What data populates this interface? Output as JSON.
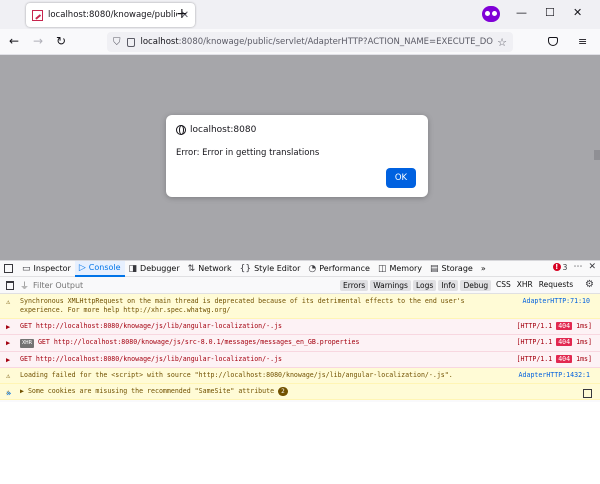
{
  "browser": {
    "tab_title": "localhost:8080/knowage/public",
    "tab_close": "✕",
    "new_tab": "+",
    "window_controls": {
      "minimize": "—",
      "maximize": "☐",
      "close": "✕"
    },
    "nav": {
      "back": "←",
      "forward": "→",
      "reload": "↻",
      "star": "☆",
      "menu": "≡"
    },
    "url_host": "localhost",
    "url_rest": ":8080/knowage/public/servlet/AdapterHTTP?ACTION_NAME=EXECUTE_DOCU"
  },
  "dialog": {
    "origin": "localhost:8080",
    "message": "Error: Error in getting translations",
    "ok_label": "OK"
  },
  "devtools": {
    "tabs": [
      {
        "label": "Inspector",
        "icon": "▭"
      },
      {
        "label": "Console",
        "icon": "▷"
      },
      {
        "label": "Debugger",
        "icon": "◨"
      },
      {
        "label": "Network",
        "icon": "⇅"
      },
      {
        "label": "Style Editor",
        "icon": "{}"
      },
      {
        "label": "Performance",
        "icon": "◔"
      },
      {
        "label": "Memory",
        "icon": "◫"
      },
      {
        "label": "Storage",
        "icon": "▤"
      },
      {
        "label": "»",
        "icon": ""
      }
    ],
    "error_count": "3",
    "filter_placeholder": "Filter Output",
    "filter_buttons": [
      "Errors",
      "Warnings",
      "Logs",
      "Info",
      "Debug"
    ],
    "filter_links": [
      "CSS",
      "XHR",
      "Requests"
    ],
    "messages": [
      {
        "type": "warning",
        "text": "Synchronous XMLHttpRequest on the main thread is deprecated because of its detrimental effects to the end user's experience. For more help http://xhr.spec.whatwg.org/",
        "location": "AdapterHTTP:71:10"
      },
      {
        "type": "error",
        "text": "GET http://localhost:8080/knowage/js/lib/angular-localization/-.js",
        "http": "[HTTP/1.1",
        "code": "404",
        "time": "1ms]"
      },
      {
        "type": "error",
        "text": "GET http://localhost:8080/knowage/js/src-8.0.1/messages/messages_en_GB.properties",
        "http": "[HTTP/1.1",
        "code": "404",
        "time": "1ms]",
        "xhr": "XHR"
      },
      {
        "type": "error",
        "text": "GET http://localhost:8080/knowage/js/lib/angular-localization/-.js",
        "http": "[HTTP/1.1",
        "code": "404",
        "time": "1ms]"
      },
      {
        "type": "warning",
        "text": "Loading failed for the <script> with source \"http://localhost:8080/knowage/js/lib/angular-localization/-.js\".",
        "location": "AdapterHTTP:1432:1"
      },
      {
        "type": "warning",
        "text": "▶ Some cookies are misusing the recommended \"SameSite\" attribute",
        "count": "2"
      }
    ],
    "prompt": "»"
  }
}
